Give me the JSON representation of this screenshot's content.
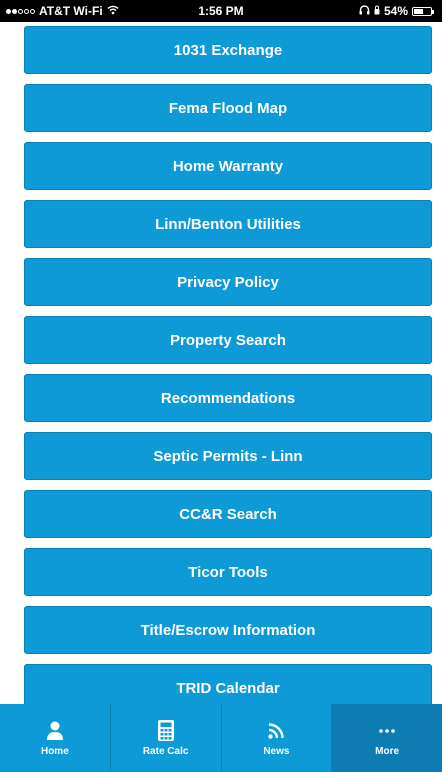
{
  "status_bar": {
    "carrier": "AT&T Wi-Fi",
    "time": "1:56 PM",
    "battery_percent": "54%",
    "battery_level": 0.54,
    "signal_bars_filled": 2,
    "signal_bars_total": 5
  },
  "menu": {
    "items": [
      {
        "label": "1031 Exchange"
      },
      {
        "label": "Fema Flood Map"
      },
      {
        "label": "Home Warranty"
      },
      {
        "label": "Linn/Benton Utilities"
      },
      {
        "label": "Privacy Policy"
      },
      {
        "label": "Property Search"
      },
      {
        "label": "Recommendations"
      },
      {
        "label": "Septic Permits - Linn"
      },
      {
        "label": "CC&R Search"
      },
      {
        "label": "Ticor Tools"
      },
      {
        "label": "Title/Escrow Information"
      },
      {
        "label": "TRID Calendar"
      }
    ]
  },
  "tab_bar": {
    "tabs": [
      {
        "label": "Home",
        "icon": "person-icon"
      },
      {
        "label": "Rate Calc",
        "icon": "calculator-icon"
      },
      {
        "label": "News",
        "icon": "rss-icon"
      },
      {
        "label": "More",
        "icon": "more-dots-icon"
      }
    ],
    "active": "More"
  },
  "colors": {
    "accent": "#0e9ad7",
    "accent_dark": "#0c7cb2",
    "status_bar_bg": "#000000"
  }
}
